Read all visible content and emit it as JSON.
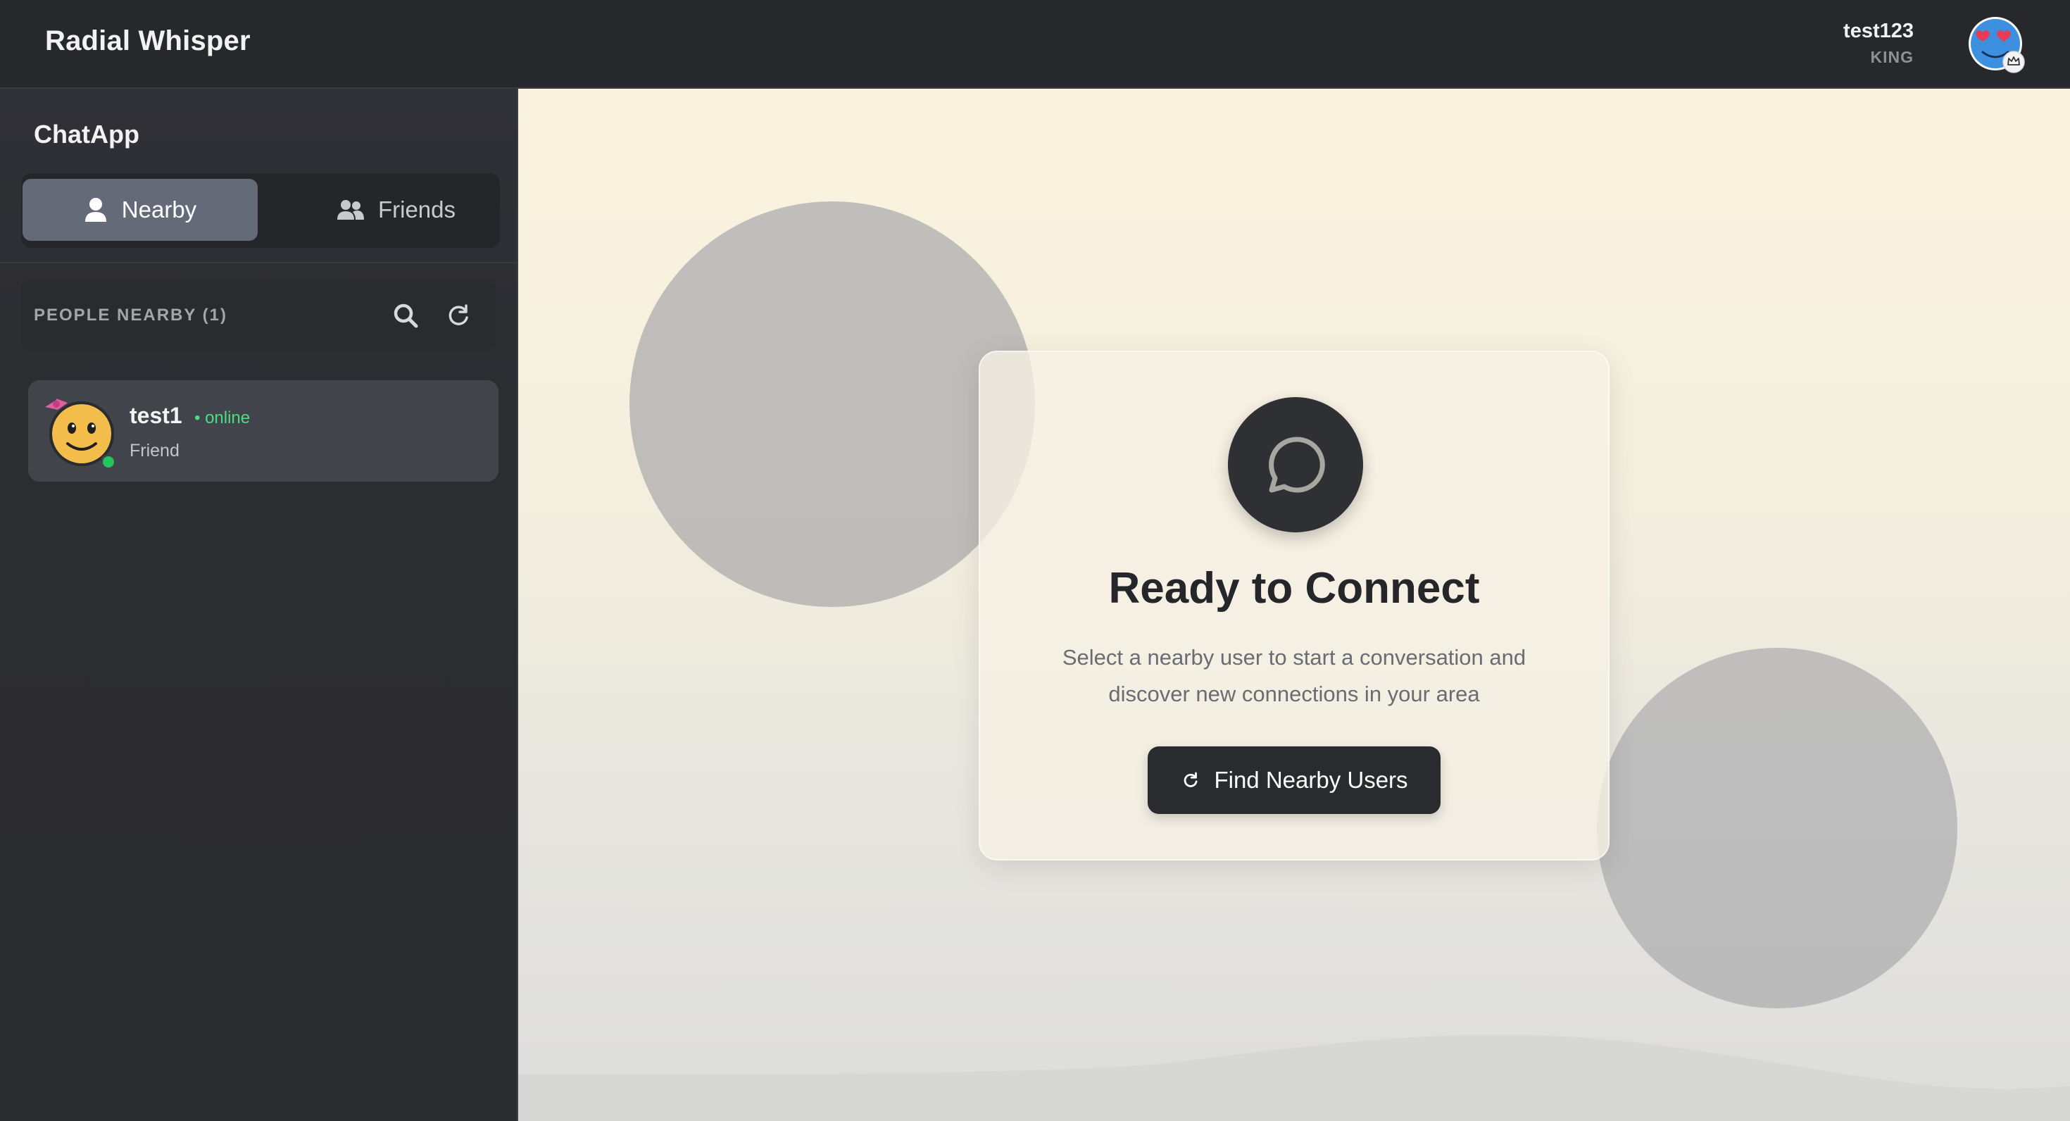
{
  "header": {
    "app_title": "Radial Whisper",
    "user": {
      "name": "test123",
      "rank": "KING",
      "avatar_icon": "heart-eyes-face-icon",
      "badge_icon": "crown-icon"
    }
  },
  "sidebar": {
    "title": "ChatApp",
    "tabs": [
      {
        "label": "Nearby",
        "icon": "user-icon",
        "active": true
      },
      {
        "label": "Friends",
        "icon": "users-icon",
        "active": false
      }
    ],
    "section_label": "PEOPLE NEARBY (1)",
    "actions": {
      "search_icon": "search-icon",
      "refresh_icon": "refresh-icon"
    },
    "users": [
      {
        "name": "test1",
        "status": "• online",
        "relation": "Friend",
        "avatar_icon": "smiley-bow-icon",
        "online": true
      }
    ]
  },
  "main": {
    "title": "Ready to Connect",
    "description": "Select a nearby user to start a conversation and discover new connections in your area",
    "icon": "chat-bubble-icon",
    "button_label": "Find Nearby Users",
    "button_icon": "refresh-icon"
  },
  "colors": {
    "accent_online": "#4ade80",
    "tab_active": "#656a78",
    "dark": "#2a2b2f"
  }
}
